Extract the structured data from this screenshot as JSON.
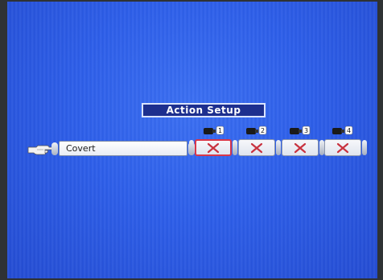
{
  "title": "Action Setup",
  "row": {
    "pointer_icon": "hand-pointer-icon",
    "field_label": "Covert"
  },
  "cameras": [
    {
      "number": "1",
      "state_icon": "x-icon",
      "selected": true
    },
    {
      "number": "2",
      "state_icon": "x-icon",
      "selected": false
    },
    {
      "number": "3",
      "state_icon": "x-icon",
      "selected": false
    },
    {
      "number": "4",
      "state_icon": "x-icon",
      "selected": false
    }
  ],
  "colors": {
    "screen_blue": "#2d5ee9",
    "title_bg": "#1d2f8f",
    "x_mark": "#c8323f",
    "selected_border": "#d8374a"
  }
}
